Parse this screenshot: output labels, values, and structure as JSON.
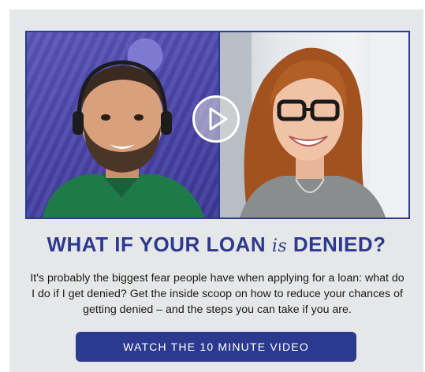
{
  "video": {
    "left_person": "man with headset and green shirt",
    "right_person": "smiling woman with glasses",
    "play_icon": "play-circle-icon"
  },
  "title": {
    "part1": "WHAT IF YOUR LOAN ",
    "part2": "is",
    "part3": " DENIED?"
  },
  "description": "It's probably the biggest fear people have when applying for a loan: what do I do if I get denied? Get the inside scoop on how to reduce your chances of getting denied – and the steps you can take if you are.",
  "cta": {
    "label": "WATCH THE 10 MINUTE VIDEO"
  },
  "colors": {
    "brand": "#2b3a8f",
    "background": "#e6e7e8"
  }
}
